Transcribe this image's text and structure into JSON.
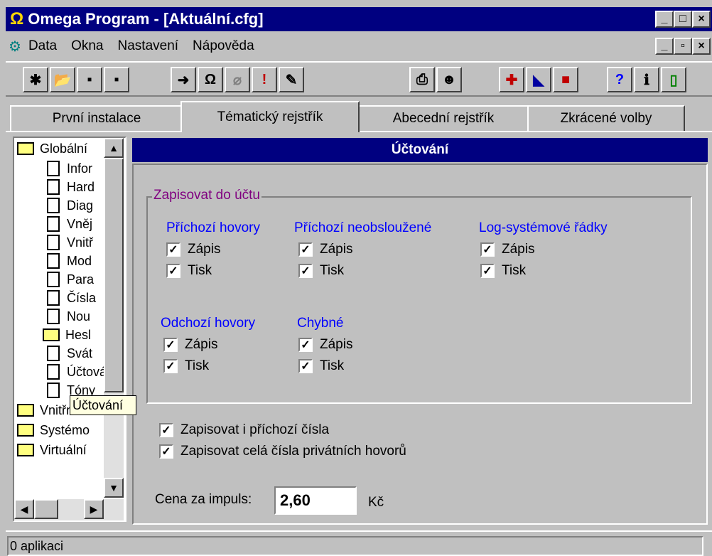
{
  "window": {
    "omega": "Ω",
    "title": "Omega Program - [Aktuální.cfg]"
  },
  "menu": [
    "Data",
    "Okna",
    "Nastavení",
    "Nápověda"
  ],
  "tabs": [
    "První instalace",
    "Tématický rejstřík",
    "Abecední rejstřík",
    "Zkrácené volby"
  ],
  "tree": {
    "items": [
      "Globální",
      "Infor",
      "Hard",
      "Diag",
      "Vněj",
      "Vnitř",
      "Mod",
      "Para",
      "Čísla",
      "Nou",
      "Hesl",
      "Svát",
      "Účtování",
      "Tóny",
      "Vnitřní li",
      "Systémo",
      "Virtuální"
    ],
    "tooltip": "Účtování"
  },
  "section": {
    "title": "Účtování"
  },
  "group": {
    "title": "Zapisovat do účtu"
  },
  "categories": [
    "Příchozí hovory",
    "Příchozí neobsloužené",
    "Log-systémové řádky",
    "Odchozí hovory",
    "Chybné"
  ],
  "check_labels": {
    "zapis": "Zápis",
    "tisk": "Tisk"
  },
  "options": [
    "Zapisovat i příchozí čísla",
    "Zapisovat celá čísla privátních hovorů"
  ],
  "price": {
    "label": "Cena za impuls:",
    "value": "2,60",
    "unit": "Kč"
  },
  "status": "0 aplikaci",
  "colors": {
    "titlebar": "#000080",
    "group_title": "#800080",
    "category": "#0000ff"
  }
}
